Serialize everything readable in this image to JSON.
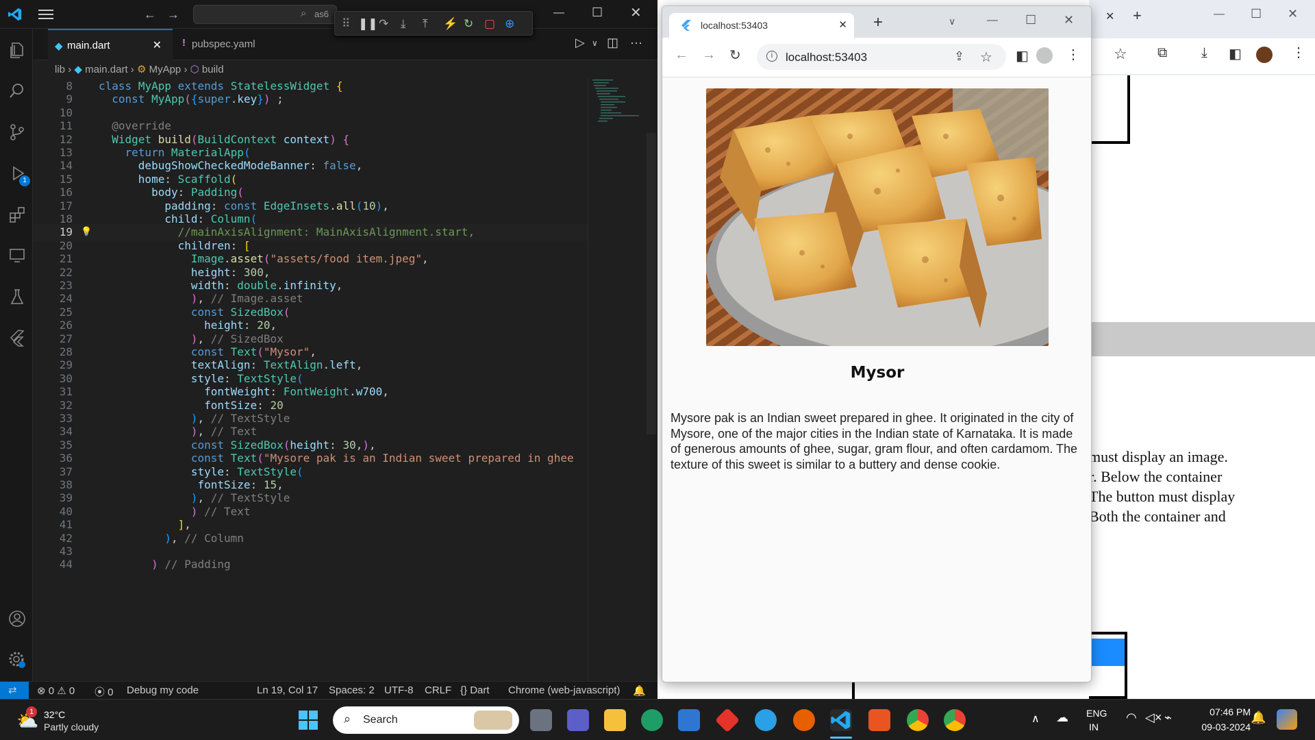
{
  "vscode": {
    "search_text": "as6",
    "tabs": [
      {
        "label": "main.dart",
        "active": true
      },
      {
        "label": "pubspec.yaml",
        "active": false
      }
    ],
    "breadcrumb": [
      "lib",
      "main.dart",
      "MyApp",
      "build"
    ],
    "lines": [
      {
        "n": "8",
        "h": "<span class='kw'>class</span> <span class='ty'>MyApp</span> <span class='kw'>extends</span> <span class='ty'>StatelessWidget</span> <span class='br1'>{</span>"
      },
      {
        "n": "9",
        "h": "  <span class='kw'>const</span> <span class='ty'>MyApp</span><span class='br2'>(</span><span class='br3'>{</span><span class='kw'>super</span>.<span class='pr'>key</span><span class='br3'>}</span><span class='br2'>)</span> ;"
      },
      {
        "n": "10",
        "h": ""
      },
      {
        "n": "11",
        "h": "  <span class='cm'>@override</span>"
      },
      {
        "n": "12",
        "h": "  <span class='ty'>Widget</span> <span class='fn'>build</span><span class='br2'>(</span><span class='ty'>BuildContext</span> <span class='pr'>context</span><span class='br2'>)</span> <span class='br2'>{</span>"
      },
      {
        "n": "13",
        "h": "    <span class='kw'>return</span> <span class='ty'>MaterialApp</span><span class='br3'>(</span>"
      },
      {
        "n": "14",
        "h": "      <span class='pr'>debugShowCheckedModeBanner</span>: <span class='kw'>false</span>,"
      },
      {
        "n": "15",
        "h": "      <span class='pr'>home</span>: <span class='ty'>Scaffold</span><span class='br1'>(</span>"
      },
      {
        "n": "16",
        "h": "        <span class='pr'>body</span>: <span class='ty'>Padding</span><span class='br2'>(</span>"
      },
      {
        "n": "17",
        "h": "          <span class='pr'>padding</span>: <span class='kw'>const</span> <span class='ty'>EdgeInsets</span>.<span class='fn'>all</span><span class='br3'>(</span><span class='nu'>10</span><span class='br3'>)</span>,"
      },
      {
        "n": "18",
        "h": "          <span class='pr'>child</span>: <span class='ty'>Column</span><span class='br3'>(</span>"
      },
      {
        "n": "19",
        "h": "            <span class='cmt'>//mainAxisAlignment: MainAxisAlignment.start,</span>"
      },
      {
        "n": "20",
        "h": "            <span class='pr'>children</span>: <span class='br1'>[</span>"
      },
      {
        "n": "21",
        "h": "              <span class='ty'>Image</span>.<span class='fn'>asset</span><span class='br2'>(</span><span class='st'>\"assets/food item.jpeg\"</span>,"
      },
      {
        "n": "22",
        "h": "              <span class='pr'>height</span>: <span class='nu'>300</span>,"
      },
      {
        "n": "23",
        "h": "              <span class='pr'>width</span>: <span class='ty'>double</span>.<span class='pr'>infinity</span>,"
      },
      {
        "n": "24",
        "h": "              <span class='br2'>)</span>, <span class='cm'>// Image.asset</span>"
      },
      {
        "n": "25",
        "h": "              <span class='kw'>const</span> <span class='ty'>SizedBox</span><span class='br2'>(</span>"
      },
      {
        "n": "26",
        "h": "                <span class='pr'>height</span>: <span class='nu'>20</span>,"
      },
      {
        "n": "27",
        "h": "              <span class='br2'>)</span>, <span class='cm'>// SizedBox</span>"
      },
      {
        "n": "28",
        "h": "              <span class='kw'>const</span> <span class='ty'>Text</span><span class='br2'>(</span><span class='st'>\"Mysor\"</span>,"
      },
      {
        "n": "29",
        "h": "              <span class='pr'>textAlign</span>: <span class='ty'>TextAlign</span>.<span class='pr'>left</span>,"
      },
      {
        "n": "30",
        "h": "              <span class='pr'>style</span>: <span class='ty'>TextStyle</span><span class='br3'>(</span>"
      },
      {
        "n": "31",
        "h": "                <span class='pr'>fontWeight</span>: <span class='ty'>FontWeight</span>.<span class='pr'>w700</span>,"
      },
      {
        "n": "32",
        "h": "                <span class='pr'>fontSize</span>: <span class='nu'>20</span>"
      },
      {
        "n": "33",
        "h": "              <span class='br3'>)</span>, <span class='cm'>// TextStyle</span>"
      },
      {
        "n": "34",
        "h": "              <span class='br2'>)</span>, <span class='cm'>// Text</span>"
      },
      {
        "n": "35",
        "h": "              <span class='kw'>const</span> <span class='ty'>SizedBox</span><span class='br2'>(</span><span class='pr'>height</span>: <span class='nu'>30</span>,<span class='br2'>)</span>,"
      },
      {
        "n": "36",
        "h": "              <span class='kw'>const</span> <span class='ty'>Text</span><span class='br2'>(</span><span class='st'>\"Mysore pak is an Indian sweet prepared in ghee</span>"
      },
      {
        "n": "37",
        "h": "              <span class='pr'>style</span>: <span class='ty'>TextStyle</span><span class='br3'>(</span>"
      },
      {
        "n": "38",
        "h": "               <span class='pr'>fontSize</span>: <span class='nu'>15</span>,"
      },
      {
        "n": "39",
        "h": "              <span class='br3'>)</span>, <span class='cm'>// TextStyle</span>"
      },
      {
        "n": "40",
        "h": "              <span class='br2'>)</span> <span class='cm'>// Text</span>"
      },
      {
        "n": "41",
        "h": "            <span class='br1'>]</span>,"
      },
      {
        "n": "42",
        "h": "          <span class='br3'>)</span>, <span class='cm'>// Column</span>"
      },
      {
        "n": "43",
        "h": ""
      },
      {
        "n": "44",
        "h": "        <span class='br2'>)</span> <span class='cm'>// Padding</span>"
      }
    ],
    "status": {
      "errors": "0",
      "warnings": "0",
      "ports": "0",
      "debug": "Debug my code",
      "position": "Ln 19, Col 17",
      "spaces": "Spaces: 2",
      "encoding": "UTF-8",
      "eol": "CRLF",
      "language": "Dart",
      "device": "Chrome (web-javascript)"
    },
    "debug_badge": "1"
  },
  "chrome": {
    "tab_title": "localhost:53403",
    "url": "localhost:53403"
  },
  "app": {
    "title": "Mysor",
    "description": "Mysore pak is an Indian sweet prepared in ghee. It originated in the city of Mysore, one of the major cities in the Indian state of Karnataka. It is made of generous amounts of ghee, sugar, gram flour, and often cardamom. The texture of this sweet is similar to a buttery and dense cookie."
  },
  "background_doc": {
    "lines": [
      "must display an image.",
      "r. Below the container",
      " The button must display",
      " Both the container and"
    ]
  },
  "taskbar": {
    "weather_temp": "32°C",
    "weather_desc": "Partly cloudy",
    "weather_badge": "1",
    "search_label": "Search",
    "lang": "ENG",
    "region": "IN",
    "time": "07:46 PM",
    "date": "09-03-2024"
  },
  "colors": {
    "accent": "#0078d4",
    "chrome_bg": "#dee1e6"
  }
}
